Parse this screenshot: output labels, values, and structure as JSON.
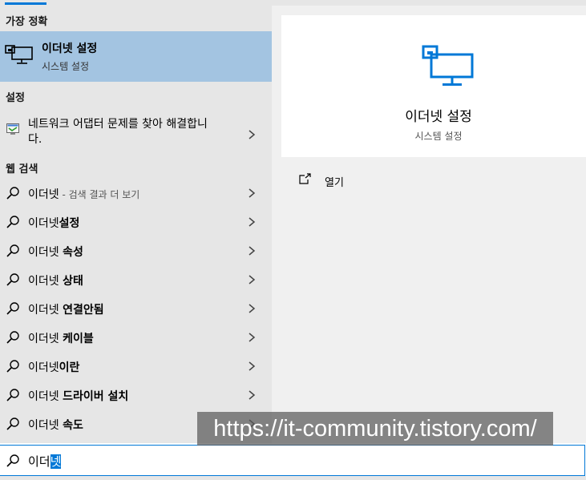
{
  "sections": {
    "best_match": "가장 정확",
    "settings": "설정",
    "web_search": "웹 검색"
  },
  "best_match": {
    "title": "이더넷 설정",
    "subtitle": "시스템 설정",
    "icon": "ethernet-monitor-icon"
  },
  "settings_result": {
    "label": "네트워크 어댑터 문제를 찾아 해결합니다.",
    "icon": "troubleshoot-icon"
  },
  "web_results": [
    {
      "prefix": "이더넷",
      "bold": "",
      "hint": " - 검색 결과 더 보기"
    },
    {
      "prefix": "이더넷",
      "bold": "설정",
      "hint": ""
    },
    {
      "prefix": "이더넷 ",
      "bold": "속성",
      "hint": ""
    },
    {
      "prefix": "이더넷 ",
      "bold": "상태",
      "hint": ""
    },
    {
      "prefix": "이더넷 ",
      "bold": "연결안됨",
      "hint": ""
    },
    {
      "prefix": "이더넷 ",
      "bold": "케이블",
      "hint": ""
    },
    {
      "prefix": "이더넷",
      "bold": "이란",
      "hint": ""
    },
    {
      "prefix": "이더넷 ",
      "bold": "드라이버 설치",
      "hint": ""
    },
    {
      "prefix": "이더넷 ",
      "bold": "속도",
      "hint": ""
    }
  ],
  "detail": {
    "title": "이더넷 설정",
    "subtitle": "시스템 설정",
    "actions": [
      {
        "label": "열기",
        "icon": "open-external-icon"
      }
    ]
  },
  "search": {
    "query_prefix": "이더",
    "query_selected": "넷"
  },
  "watermark": "https://it-community.tistory.com/",
  "colors": {
    "accent": "#0078d7",
    "selected_bg": "#a3c4e1",
    "left_panel_bg": "#e6e6e6",
    "right_panel_bg": "#f0f0f0"
  }
}
